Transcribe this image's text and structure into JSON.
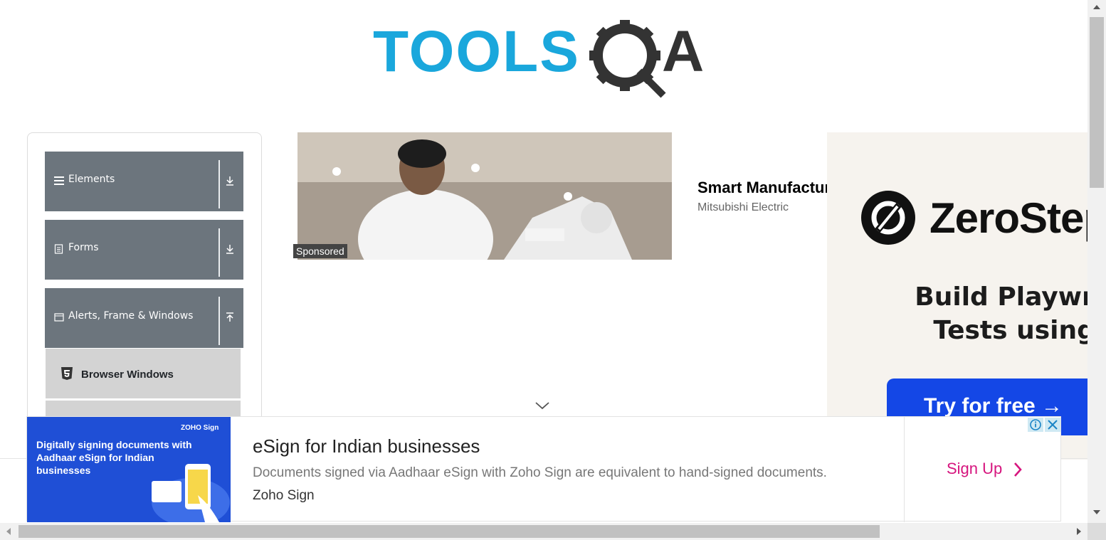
{
  "header": {
    "logo_text_left": "TOOLS",
    "logo_text_right": "QA",
    "colors": {
      "tools": "#1aa7dc",
      "qa": "#333333"
    }
  },
  "sidebar": {
    "groups": [
      {
        "label": "Elements",
        "icon": "hamburger-icon",
        "state": "collapsed"
      },
      {
        "label": "Forms",
        "icon": "form-icon",
        "state": "collapsed"
      },
      {
        "label": "Alerts, Frame & Windows",
        "icon": "window-icon",
        "state": "expanded"
      }
    ],
    "active_item": {
      "label": "Browser Windows",
      "icon": "html5-icon"
    }
  },
  "sponsored": {
    "tag": "Sponsored",
    "title": "Smart Manufacturing",
    "advertiser": "Mitsubishi Electric"
  },
  "right_ad": {
    "brand": "ZeroStep",
    "headline": "Build Playwright\nTests using AI",
    "cta": "Try for free →"
  },
  "bottom_ad": {
    "image_text": "Digitally signing documents with Aadhaar eSign for Indian businesses",
    "image_brand": "ZOHO Sign",
    "title": "eSign for Indian businesses",
    "description": "Documents signed via Aadhaar eSign with Zoho Sign are equivalent to hand-signed documents.",
    "source": "Zoho Sign",
    "cta": "Sign Up",
    "cta_color": "#d6157e"
  },
  "colors": {
    "sidebar_group": "#6c757d",
    "active_item": "#d3d3d3",
    "ad_button": "#1447e6"
  }
}
